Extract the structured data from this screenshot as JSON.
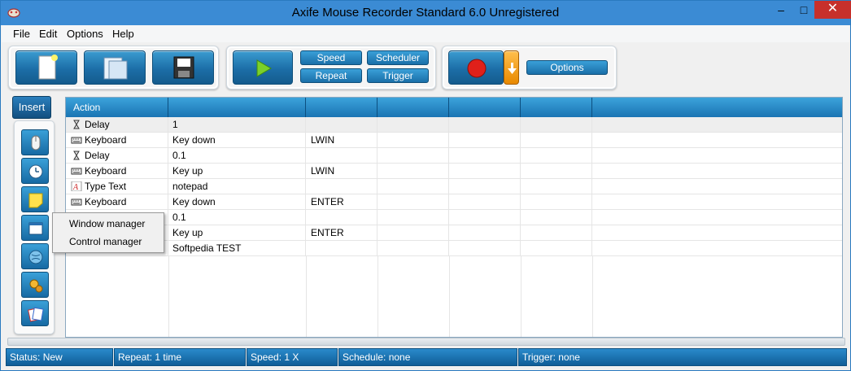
{
  "window": {
    "title": "Axife Mouse Recorder Standard 6.0 Unregistered",
    "minimize": "–",
    "maximize": "□",
    "close": "✕"
  },
  "menu": [
    "File",
    "Edit",
    "Options",
    "Help"
  ],
  "toolbar": {
    "speed_label": "Speed",
    "repeat_label": "Repeat",
    "scheduler_label": "Scheduler",
    "trigger_label": "Trigger",
    "options_label": "Options"
  },
  "insert": {
    "label": "Insert",
    "side_icons": [
      "mouse-icon",
      "clock-icon",
      "note-icon",
      "window-icon",
      "globe-icon",
      "gears-icon",
      "cards-icon"
    ]
  },
  "grid": {
    "header": [
      "Action",
      "",
      "",
      "",
      "",
      "",
      ""
    ],
    "rows": [
      {
        "icon": "hourglass-icon",
        "action": "Delay",
        "value1": "1",
        "value2": ""
      },
      {
        "icon": "keyboard-icon",
        "action": "Keyboard",
        "value1": "Key down",
        "value2": "LWIN"
      },
      {
        "icon": "hourglass-icon",
        "action": "Delay",
        "value1": "0.1",
        "value2": ""
      },
      {
        "icon": "keyboard-icon",
        "action": "Keyboard",
        "value1": "Key up",
        "value2": "LWIN"
      },
      {
        "icon": "type-text-icon",
        "action": "Type Text",
        "value1": "notepad",
        "value2": ""
      },
      {
        "icon": "keyboard-icon",
        "action": "Keyboard",
        "value1": "Key down",
        "value2": "ENTER"
      },
      {
        "icon": "",
        "action": "",
        "value1": "0.1",
        "value2": ""
      },
      {
        "icon": "",
        "action": "",
        "value1": "Key up",
        "value2": "ENTER"
      },
      {
        "icon": "",
        "action": "",
        "value1": "Softpedia TEST",
        "value2": ""
      }
    ]
  },
  "popup": {
    "items": [
      "Window manager",
      "Control manager"
    ]
  },
  "status": {
    "status": "Status: New",
    "repeat": "Repeat: 1 time",
    "speed": "Speed: 1 X",
    "schedule": "Schedule: none",
    "trigger": "Trigger: none"
  },
  "colors": {
    "title_bar": "#3b8bd4",
    "accent_blue": "#1a74b3",
    "close_red": "#c7302b",
    "record_red": "#e0201a",
    "play_green": "#7bd02a"
  }
}
